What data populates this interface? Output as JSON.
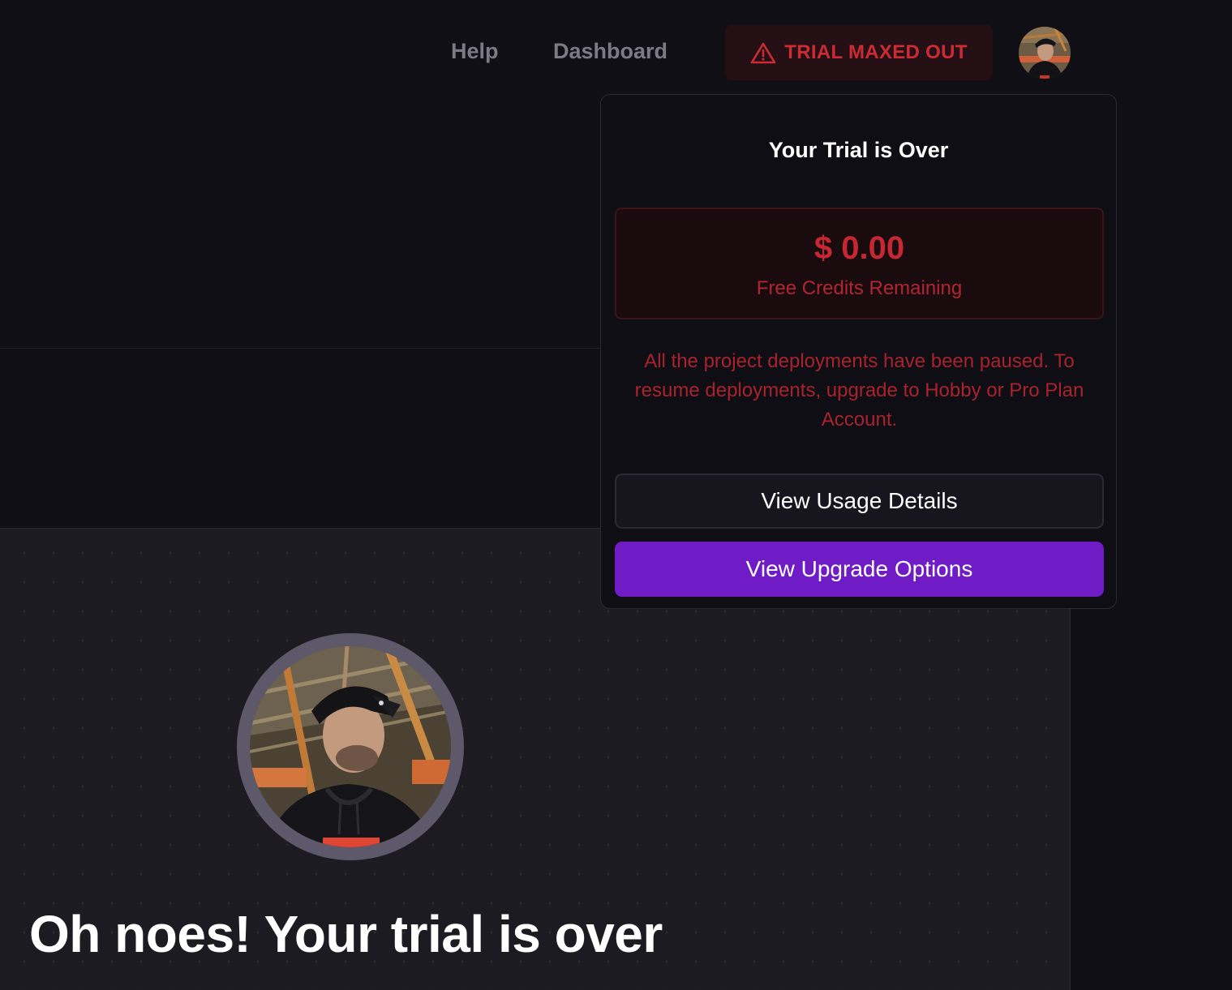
{
  "nav": {
    "help": "Help",
    "dashboard": "Dashboard",
    "trial_badge": "TRIAL MAXED OUT",
    "trial_badge_icon": "warning-triangle-icon",
    "avatar_alt": "user-avatar"
  },
  "dropdown": {
    "title": "Your Trial is Over",
    "credits_amount": "$ 0.00",
    "credits_label": "Free Credits Remaining",
    "message": "All the project deployments have been paused. To resume deployments, upgrade to Hobby or Pro Plan Account.",
    "usage_button": "View Usage Details",
    "upgrade_button": "View Upgrade Options"
  },
  "main": {
    "title": "Oh noes! Your trial is over"
  },
  "colors": {
    "background": "#100f16",
    "panel": "#1c1b21",
    "danger": "#cd2b34",
    "danger_bg": "#241014",
    "accent": "#6f1cc6",
    "nav_text": "#7b7a86"
  }
}
